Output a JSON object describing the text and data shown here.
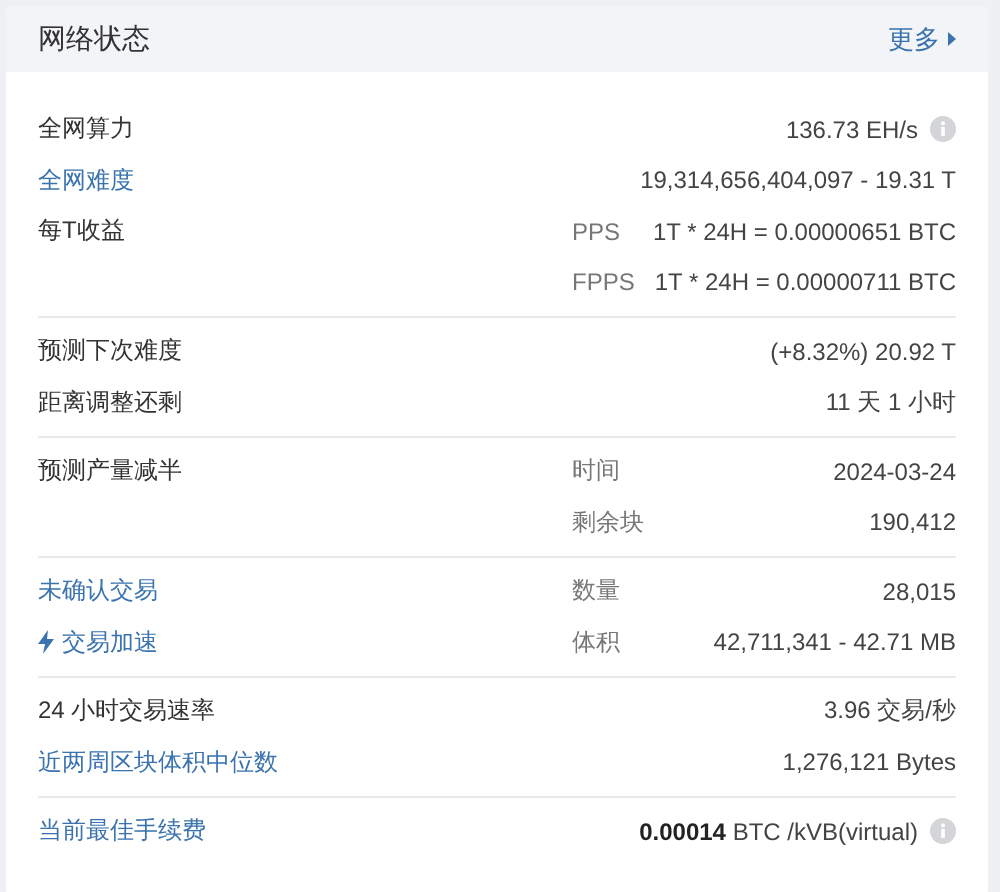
{
  "header": {
    "title": "网络状态",
    "more_link": "更多"
  },
  "sections": [
    {
      "rows": [
        {
          "label": "全网算力",
          "link": false,
          "value": "136.73 EH/s",
          "info": true
        },
        {
          "label": "全网难度",
          "link": true,
          "value": "19,314,656,404,097 - 19.31 T",
          "info": false
        },
        {
          "label": "每T收益",
          "link": false,
          "sublabel": "PPS",
          "value": "1T * 24H = 0.00000651 BTC",
          "info": false
        },
        {
          "sublabel": "FPPS",
          "value": "1T * 24H = 0.00000711 BTC",
          "info": false
        }
      ]
    },
    {
      "rows": [
        {
          "label": "预测下次难度",
          "link": false,
          "value": "(+8.32%) 20.92 T",
          "info": false
        },
        {
          "label": "距离调整还剩",
          "link": false,
          "value": "11 天 1 小时",
          "info": false
        }
      ]
    },
    {
      "rows": [
        {
          "label": "预测产量减半",
          "link": false,
          "sublabel": "时间",
          "value": "2024-03-24",
          "info": false
        },
        {
          "sublabel": "剩余块",
          "value": "190,412",
          "info": false
        }
      ]
    },
    {
      "rows": [
        {
          "label": "未确认交易",
          "link": true,
          "sublabel": "数量",
          "value": "28,015",
          "info": false
        },
        {
          "label": "交易加速",
          "link": true,
          "kind": "boost",
          "sublabel": "体积",
          "value": "42,711,341 - 42.71 MB",
          "info": false
        }
      ]
    },
    {
      "rows": [
        {
          "label": "24 小时交易速率",
          "link": false,
          "value": "3.96 交易/秒",
          "info": false
        },
        {
          "label": "近两周区块体积中位数",
          "link": true,
          "value": "1,276,121 Bytes",
          "info": false
        }
      ]
    },
    {
      "rows": [
        {
          "label": "当前最佳手续费",
          "link": true,
          "value": "**0.00014** BTC /kVB(virtual)",
          "info": true
        }
      ]
    }
  ]
}
